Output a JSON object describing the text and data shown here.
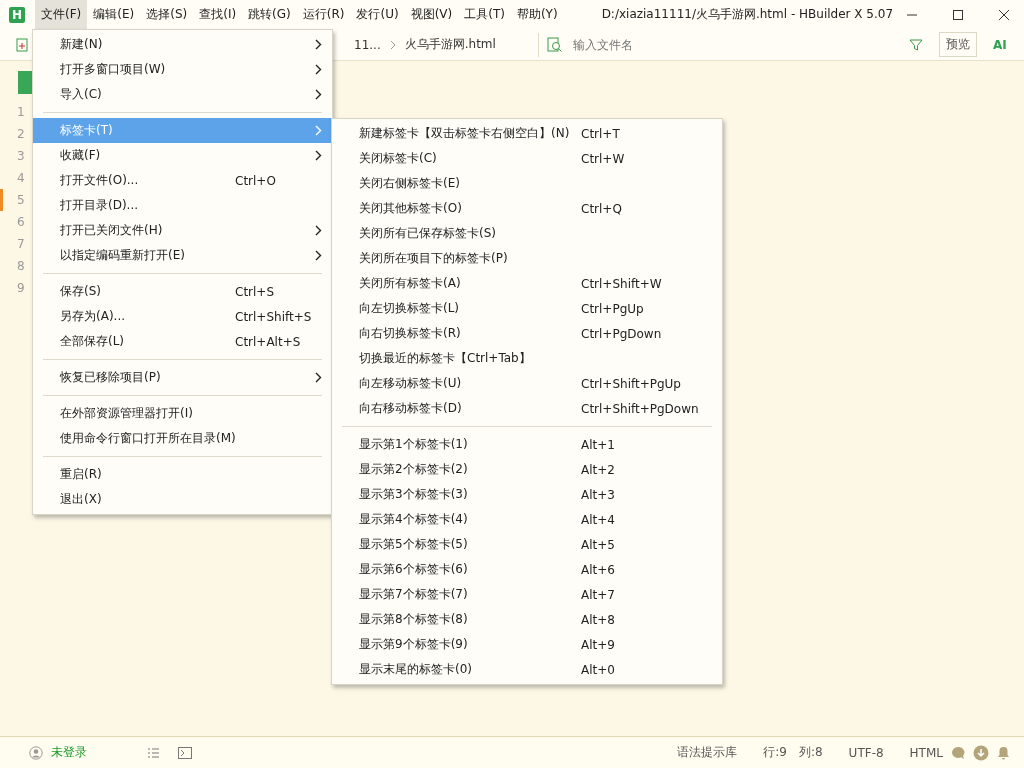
{
  "window": {
    "logo": "H",
    "title": "D:/xiazia11111/火乌手游网.html - HBuilder X 5.07"
  },
  "menubar": [
    {
      "label": "文件(F)",
      "selected": true
    },
    {
      "label": "编辑(E)",
      "selected": false
    },
    {
      "label": "选择(S)",
      "selected": false
    },
    {
      "label": "查找(I)",
      "selected": false
    },
    {
      "label": "跳转(G)",
      "selected": false
    },
    {
      "label": "运行(R)",
      "selected": false
    },
    {
      "label": "发行(U)",
      "selected": false
    },
    {
      "label": "视图(V)",
      "selected": false
    },
    {
      "label": "工具(T)",
      "selected": false
    },
    {
      "label": "帮助(Y)",
      "selected": false
    }
  ],
  "toolbar": {
    "breadcrumb": [
      "11...",
      "火乌手游网.html"
    ],
    "search": {
      "placeholder": "输入文件名"
    },
    "preview_button": "预览",
    "ai_button": "AI"
  },
  "editor": {
    "line_numbers": [
      {
        "label": "1",
        "modified": false
      },
      {
        "label": "2",
        "modified": false
      },
      {
        "label": "3",
        "modified": false
      },
      {
        "label": "4",
        "modified": false
      },
      {
        "label": "5",
        "modified": true
      },
      {
        "label": "6",
        "modified": false
      },
      {
        "label": "7",
        "modified": false
      },
      {
        "label": "8",
        "modified": false
      },
      {
        "label": "9",
        "modified": false
      }
    ]
  },
  "file_menu": [
    {
      "kind": "item",
      "label": "新建(N)",
      "submenu": true,
      "selected": false
    },
    {
      "kind": "item",
      "label": "打开多窗口项目(W)",
      "submenu": true,
      "selected": false
    },
    {
      "kind": "item",
      "label": "导入(C)",
      "submenu": true,
      "selected": false
    },
    {
      "kind": "separator"
    },
    {
      "kind": "item",
      "label": "标签卡(T)",
      "submenu": true,
      "selected": true
    },
    {
      "kind": "item",
      "label": "收藏(F)",
      "submenu": true,
      "selected": false
    },
    {
      "kind": "item",
      "label": "打开文件(O)...",
      "shortcut": "Ctrl+O",
      "submenu": false,
      "selected": false
    },
    {
      "kind": "item",
      "label": "打开目录(D)...",
      "submenu": false,
      "selected": false
    },
    {
      "kind": "item",
      "label": "打开已关闭文件(H)",
      "submenu": true,
      "selected": false
    },
    {
      "kind": "item",
      "label": "以指定编码重新打开(E)",
      "submenu": true,
      "selected": false
    },
    {
      "kind": "separator"
    },
    {
      "kind": "item",
      "label": "保存(S)",
      "shortcut": "Ctrl+S",
      "submenu": false,
      "selected": false
    },
    {
      "kind": "item",
      "label": "另存为(A)...",
      "shortcut": "Ctrl+Shift+S",
      "submenu": false,
      "selected": false
    },
    {
      "kind": "item",
      "label": "全部保存(L)",
      "shortcut": "Ctrl+Alt+S",
      "submenu": false,
      "selected": false
    },
    {
      "kind": "separator"
    },
    {
      "kind": "item",
      "label": "恢复已移除项目(P)",
      "submenu": true,
      "selected": false
    },
    {
      "kind": "separator"
    },
    {
      "kind": "item",
      "label": "在外部资源管理器打开(I)",
      "submenu": false,
      "selected": false
    },
    {
      "kind": "item",
      "label": "使用命令行窗口打开所在目录(M)",
      "submenu": false,
      "selected": false
    },
    {
      "kind": "separator"
    },
    {
      "kind": "item",
      "label": "重启(R)",
      "submenu": false,
      "selected": false
    },
    {
      "kind": "item",
      "label": "退出(X)",
      "submenu": false,
      "selected": false
    }
  ],
  "tab_submenu": [
    {
      "kind": "item",
      "label": "新建标签卡【双击标签卡右侧空白】(N)",
      "shortcut": "Ctrl+T"
    },
    {
      "kind": "item",
      "label": "关闭标签卡(C)",
      "shortcut": "Ctrl+W"
    },
    {
      "kind": "item",
      "label": "关闭右侧标签卡(E)"
    },
    {
      "kind": "item",
      "label": "关闭其他标签卡(O)",
      "shortcut": "Ctrl+Q"
    },
    {
      "kind": "item",
      "label": "关闭所有已保存标签卡(S)"
    },
    {
      "kind": "item",
      "label": "关闭所在项目下的标签卡(P)"
    },
    {
      "kind": "item",
      "label": "关闭所有标签卡(A)",
      "shortcut": "Ctrl+Shift+W"
    },
    {
      "kind": "item",
      "label": "向左切换标签卡(L)",
      "shortcut": "Ctrl+PgUp"
    },
    {
      "kind": "item",
      "label": "向右切换标签卡(R)",
      "shortcut": "Ctrl+PgDown"
    },
    {
      "kind": "item",
      "label": "切换最近的标签卡【Ctrl+Tab】"
    },
    {
      "kind": "item",
      "label": "向左移动标签卡(U)",
      "shortcut": "Ctrl+Shift+PgUp"
    },
    {
      "kind": "item",
      "label": "向右移动标签卡(D)",
      "shortcut": "Ctrl+Shift+PgDown"
    },
    {
      "kind": "separator"
    },
    {
      "kind": "item",
      "label": "显示第1个标签卡(1)",
      "shortcut": "Alt+1"
    },
    {
      "kind": "item",
      "label": "显示第2个标签卡(2)",
      "shortcut": "Alt+2"
    },
    {
      "kind": "item",
      "label": "显示第3个标签卡(3)",
      "shortcut": "Alt+3"
    },
    {
      "kind": "item",
      "label": "显示第4个标签卡(4)",
      "shortcut": "Alt+4"
    },
    {
      "kind": "item",
      "label": "显示第5个标签卡(5)",
      "shortcut": "Alt+5"
    },
    {
      "kind": "item",
      "label": "显示第6个标签卡(6)",
      "shortcut": "Alt+6"
    },
    {
      "kind": "item",
      "label": "显示第7个标签卡(7)",
      "shortcut": "Alt+7"
    },
    {
      "kind": "item",
      "label": "显示第8个标签卡(8)",
      "shortcut": "Alt+8"
    },
    {
      "kind": "item",
      "label": "显示第9个标签卡(9)",
      "shortcut": "Alt+9"
    },
    {
      "kind": "item",
      "label": "显示末尾的标签卡(0)",
      "shortcut": "Alt+0"
    }
  ],
  "status_bar": {
    "login": "未登录",
    "syntax_library": "语法提示库",
    "line": "行:9",
    "column": "列:8",
    "encoding": "UTF-8",
    "language": "HTML"
  }
}
